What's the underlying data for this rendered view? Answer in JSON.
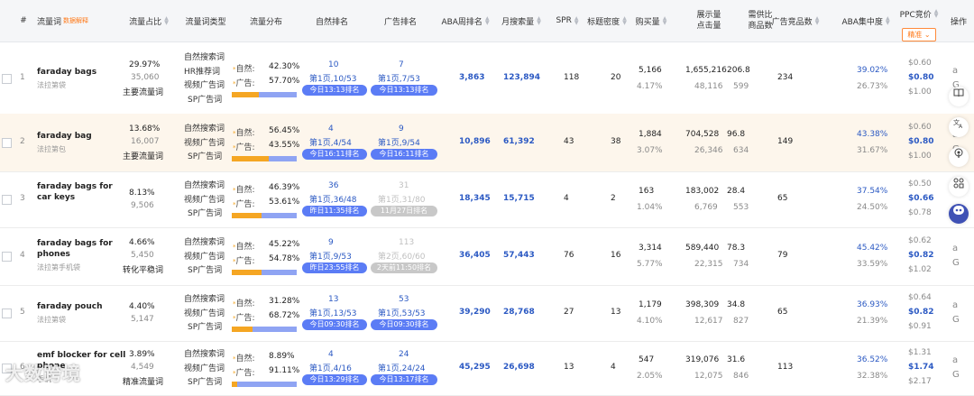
{
  "header": {
    "index": "#",
    "keyword": "流量词",
    "keyword_tag": "数据解释",
    "share": "流量占比",
    "type": "流量词类型",
    "dist": "流量分布",
    "natural_rank": "自然排名",
    "ad_rank": "广告排名",
    "aba_week": "ABA周排名",
    "monthly": "月搜索量",
    "spr": "SPR",
    "title_density": "标题密度",
    "purchases": "购买量",
    "impressions_1": "展示量",
    "impressions_2": "点击量",
    "supply_1": "需供比",
    "supply_2": "商品数",
    "ad_goods": "广告竞品数",
    "aba_conc": "ABA集中度",
    "ppc": "PPC竞价",
    "ppc_btn": "精准 ⌄",
    "ops": "操作"
  },
  "rows": [
    {
      "idx": "1",
      "kw1": "faraday bags",
      "kw2": "",
      "cn": "法拉第袋",
      "share_pct": "29.97%",
      "share_num": "35,060",
      "share_tag": "主要流量词",
      "types": [
        "自然搜索词",
        "HR推荐词",
        "视频广告词",
        "SP广告词"
      ],
      "nat_label": "自然:",
      "nat_pct": "42.30%",
      "ad_label": "广告:",
      "ad_pct": "57.70%",
      "nat_frac": 0.423,
      "nr_num": "10",
      "nr_page": "第1页,10/53",
      "nr_time": "今日13:13排名",
      "nr_muted": false,
      "ar_num": "7",
      "ar_page": "第1页,7/53",
      "ar_time": "今日13:13排名",
      "ar_muted": false,
      "aba": "3,863",
      "monthly": "123,894",
      "spr": "118",
      "density": "20",
      "buy": "5,166",
      "buy_pct": "4.17%",
      "imp": "1,655,216",
      "clk": "48,116",
      "ratio": "206.8",
      "goods": "599",
      "ad_goods": "234",
      "conc1": "39.02%",
      "conc2": "26.73%",
      "ppc1": "$0.60",
      "ppc2": "$0.80",
      "ppc3": "$1.00",
      "highlight": false
    },
    {
      "idx": "2",
      "kw1": "faraday bag",
      "kw2": "",
      "cn": "法拉第包",
      "share_pct": "13.68%",
      "share_num": "16,007",
      "share_tag": "主要流量词",
      "types": [
        "自然搜索词",
        "视频广告词",
        "SP广告词"
      ],
      "nat_label": "自然:",
      "nat_pct": "56.45%",
      "ad_label": "广告:",
      "ad_pct": "43.55%",
      "nat_frac": 0.5645,
      "nr_num": "4",
      "nr_page": "第1页,4/54",
      "nr_time": "今日16:11排名",
      "nr_muted": false,
      "ar_num": "9",
      "ar_page": "第1页,9/54",
      "ar_time": "今日16:11排名",
      "ar_muted": false,
      "aba": "10,896",
      "monthly": "61,392",
      "spr": "43",
      "density": "38",
      "buy": "1,884",
      "buy_pct": "3.07%",
      "imp": "704,528",
      "clk": "26,346",
      "ratio": "96.8",
      "goods": "634",
      "ad_goods": "149",
      "conc1": "43.38%",
      "conc2": "31.67%",
      "ppc1": "$0.60",
      "ppc2": "$0.80",
      "ppc3": "$1.00",
      "highlight": true
    },
    {
      "idx": "3",
      "kw1": "faraday bags for",
      "kw2": "car keys",
      "cn": "",
      "share_pct": "8.13%",
      "share_num": "9,506",
      "share_tag": "",
      "types": [
        "自然搜索词",
        "视频广告词",
        "SP广告词"
      ],
      "nat_label": "自然:",
      "nat_pct": "46.39%",
      "ad_label": "广告:",
      "ad_pct": "53.61%",
      "nat_frac": 0.4639,
      "nr_num": "36",
      "nr_page": "第1页,36/48",
      "nr_time": "昨日11:35排名",
      "nr_muted": false,
      "ar_num": "31",
      "ar_page": "第1页,31/80",
      "ar_time": "11月27日排名",
      "ar_muted": true,
      "aba": "18,345",
      "monthly": "15,715",
      "spr": "4",
      "density": "2",
      "buy": "163",
      "buy_pct": "1.04%",
      "imp": "183,002",
      "clk": "6,769",
      "ratio": "28.4",
      "goods": "553",
      "ad_goods": "65",
      "conc1": "37.54%",
      "conc2": "24.50%",
      "ppc1": "$0.50",
      "ppc2": "$0.66",
      "ppc3": "$0.78",
      "highlight": false
    },
    {
      "idx": "4",
      "kw1": "faraday bags for",
      "kw2": "phones",
      "cn": "法拉第手机袋",
      "share_pct": "4.66%",
      "share_num": "5,450",
      "share_tag": "转化平稳词",
      "types": [
        "自然搜索词",
        "视频广告词",
        "SP广告词"
      ],
      "nat_label": "自然:",
      "nat_pct": "45.22%",
      "ad_label": "广告:",
      "ad_pct": "54.78%",
      "nat_frac": 0.4522,
      "nr_num": "9",
      "nr_page": "第1页,9/53",
      "nr_time": "昨日23:55排名",
      "nr_muted": false,
      "ar_num": "113",
      "ar_page": "第2页,60/60",
      "ar_time": "2天前11:50排名",
      "ar_muted": true,
      "aba": "36,405",
      "monthly": "57,443",
      "spr": "76",
      "density": "16",
      "buy": "3,314",
      "buy_pct": "5.77%",
      "imp": "589,440",
      "clk": "22,315",
      "ratio": "78.3",
      "goods": "734",
      "ad_goods": "79",
      "conc1": "45.42%",
      "conc2": "33.59%",
      "ppc1": "$0.62",
      "ppc2": "$0.82",
      "ppc3": "$1.02",
      "highlight": false
    },
    {
      "idx": "5",
      "kw1": "faraday pouch",
      "kw2": "",
      "cn": "法拉第袋",
      "share_pct": "4.40%",
      "share_num": "5,147",
      "share_tag": "",
      "types": [
        "自然搜索词",
        "视频广告词",
        "SP广告词"
      ],
      "nat_label": "自然:",
      "nat_pct": "31.28%",
      "ad_label": "广告:",
      "ad_pct": "68.72%",
      "nat_frac": 0.3128,
      "nr_num": "13",
      "nr_page": "第1页,13/53",
      "nr_time": "今日09:30排名",
      "nr_muted": false,
      "ar_num": "53",
      "ar_page": "第1页,53/53",
      "ar_time": "今日09:30排名",
      "ar_muted": false,
      "aba": "39,290",
      "monthly": "28,768",
      "spr": "27",
      "density": "13",
      "buy": "1,179",
      "buy_pct": "4.10%",
      "imp": "398,309",
      "clk": "12,617",
      "ratio": "34.8",
      "goods": "827",
      "ad_goods": "65",
      "conc1": "36.93%",
      "conc2": "21.39%",
      "ppc1": "$0.64",
      "ppc2": "$0.82",
      "ppc3": "$0.91",
      "highlight": false
    },
    {
      "idx": "6",
      "kw1": "emf blocker for cell",
      "kw2": "phone",
      "cn": "手机",
      "share_pct": "3.89%",
      "share_num": "4,549",
      "share_tag": "精准流量词",
      "types": [
        "自然搜索词",
        "视频广告词",
        "SP广告词"
      ],
      "nat_label": "自然:",
      "nat_pct": "8.89%",
      "ad_label": "广告:",
      "ad_pct": "91.11%",
      "nat_frac": 0.0889,
      "nr_num": "4",
      "nr_page": "第1页,4/16",
      "nr_time": "今日13:29排名",
      "nr_muted": false,
      "ar_num": "24",
      "ar_page": "第1页,24/24",
      "ar_time": "今日13:17排名",
      "ar_muted": false,
      "aba": "45,295",
      "monthly": "26,698",
      "spr": "13",
      "density": "4",
      "buy": "547",
      "buy_pct": "2.05%",
      "imp": "319,076",
      "clk": "12,075",
      "ratio": "31.6",
      "goods": "846",
      "ad_goods": "113",
      "conc1": "36.52%",
      "conc2": "32.38%",
      "ppc1": "$1.31",
      "ppc2": "$1.74",
      "ppc3": "$2.17",
      "highlight": false
    }
  ],
  "side_icons": [
    "book-icon",
    "translate-icon",
    "podcast-icon",
    "apps-icon",
    "chat-bot-icon"
  ],
  "ops_icons": [
    "amazon-icon",
    "google-icon"
  ],
  "watermark": "大数跨境",
  "colors": {
    "accent_blue": "#2b59c3",
    "pill_blue": "#5b7cf5",
    "orange": "#f5a623",
    "highlight_row": "#fdf6ec"
  }
}
